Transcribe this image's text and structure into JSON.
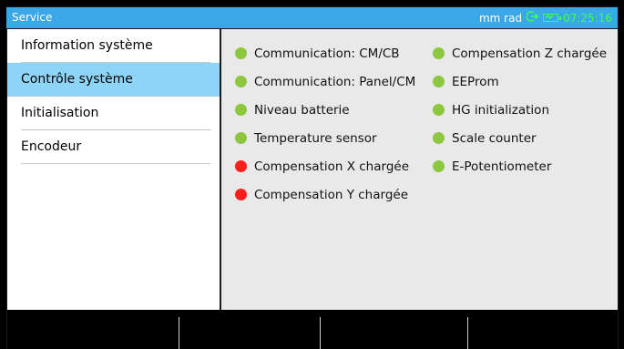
{
  "titlebar": {
    "title": "Service",
    "units": "mm rad",
    "time": "07:25:16"
  },
  "sidebar": {
    "items": [
      {
        "label": "Information système",
        "selected": false
      },
      {
        "label": "Contrôle système",
        "selected": true
      },
      {
        "label": "Initialisation",
        "selected": false
      },
      {
        "label": "Encodeur",
        "selected": false
      }
    ]
  },
  "checks": {
    "col1": [
      {
        "label": "Communication: CM/CB",
        "status": "ok"
      },
      {
        "label": "Communication: Panel/CM",
        "status": "ok"
      },
      {
        "label": "Niveau batterie",
        "status": "ok"
      },
      {
        "label": "Temperature sensor",
        "status": "ok"
      },
      {
        "label": "Compensation X chargée",
        "status": "error"
      },
      {
        "label": "Compensation Y chargée",
        "status": "error"
      }
    ],
    "col2": [
      {
        "label": "Compensation Z chargée",
        "status": "ok"
      },
      {
        "label": "EEProm",
        "status": "ok"
      },
      {
        "label": "HG initialization",
        "status": "ok"
      },
      {
        "label": "Scale counter",
        "status": "ok"
      },
      {
        "label": "E-Potentiometer",
        "status": "ok"
      }
    ]
  },
  "colors": {
    "titlebar": "#3aa7e6",
    "selected_item": "#8ed4f6",
    "status_ok": "#8dc63f",
    "status_error": "#ff1e1e",
    "clock": "#3cff5a"
  },
  "icons": {
    "connection": "arrow-right-circle-icon",
    "battery": "battery-charging-icon"
  }
}
